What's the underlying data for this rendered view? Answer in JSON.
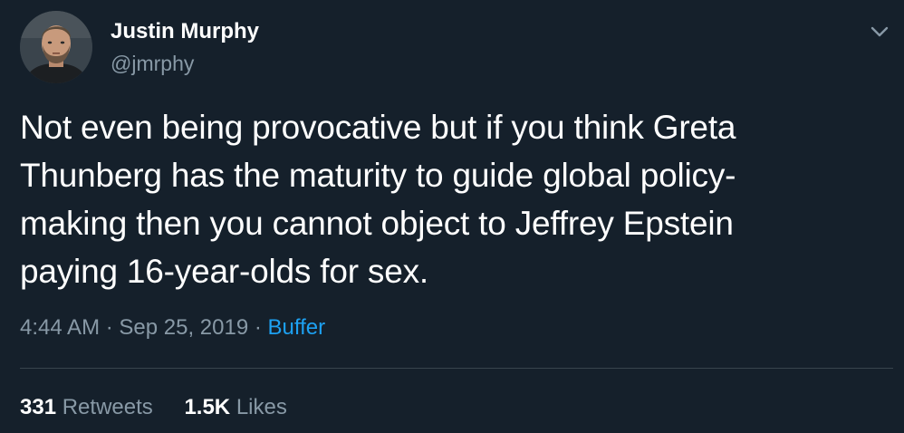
{
  "author": {
    "name": "Justin Murphy",
    "handle": "@jmrphy"
  },
  "tweet": {
    "lines": [
      "Not even being provocative but if you think Greta",
      "Thunberg has the maturity to guide global policy-",
      "making then you cannot object to Jeffrey Epstein",
      "paying 16-year-olds for sex."
    ]
  },
  "meta": {
    "time": "4:44 AM",
    "separator": "·",
    "date": "Sep 25, 2019",
    "source": "Buffer"
  },
  "stats": {
    "retweets_count": "331",
    "retweets_label": "Retweets",
    "likes_count": "1.5K",
    "likes_label": "Likes"
  },
  "icons": {
    "menu": "chevron-down-icon"
  },
  "colors": {
    "background": "#15202b",
    "text": "#ffffff",
    "secondary": "#8899a6",
    "link": "#1da1f2",
    "divider": "#38444d"
  }
}
